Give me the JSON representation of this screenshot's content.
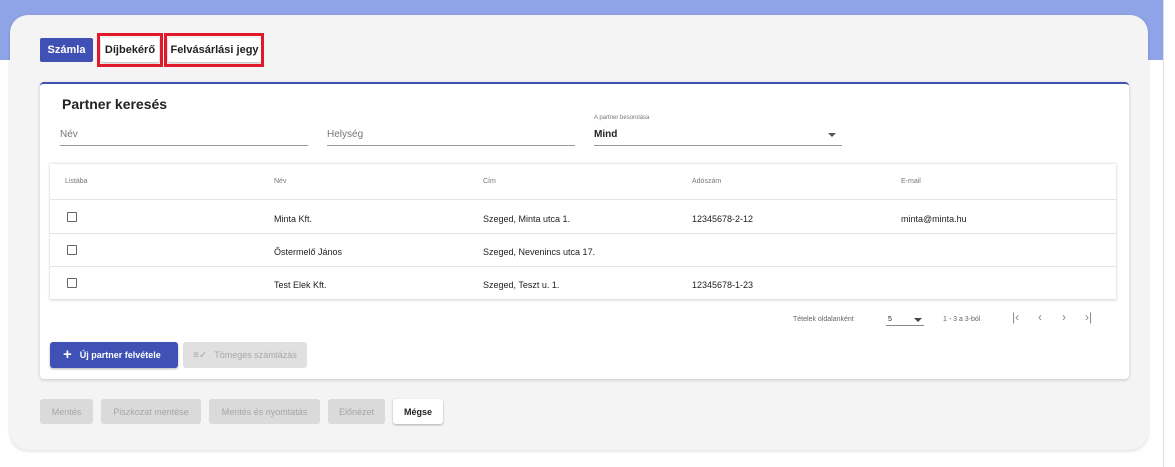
{
  "colors": {
    "primary": "#3f51b5",
    "highlight": "#e0192b",
    "band": "#8fa4e6"
  },
  "doc_tabs": [
    {
      "label": "Számla",
      "active": true
    },
    {
      "label": "Díjbekérő",
      "active": false
    },
    {
      "label": "Felvásárlási jegy",
      "active": false
    }
  ],
  "partner_search": {
    "title": "Partner keresés",
    "name_label": "Név",
    "city_label": "Helység",
    "class_label": "A partner besorolása",
    "class_value": "Mind"
  },
  "table": {
    "headers": [
      "Listába",
      "Név",
      "Cím",
      "Adószám",
      "E-mail"
    ],
    "rows": [
      {
        "name": "Minta Kft.",
        "address": "Szeged, Minta utca 1.",
        "tax": "12345678-2-12",
        "email": "minta@minta.hu"
      },
      {
        "name": "Őstermelő János",
        "address": "Szeged, Nevenincs utca 17.",
        "tax": "",
        "email": ""
      },
      {
        "name": "Test Elek Kft.",
        "address": "Szeged, Teszt u. 1.",
        "tax": "12345678-1-23",
        "email": ""
      }
    ]
  },
  "pagination": {
    "per_page_label": "Tételek oldalanként",
    "per_page_value": "5",
    "range": "1 - 3 a 3-ból"
  },
  "actions": {
    "add_partner": "Új partner felvétele",
    "bulk_invoice": "Tömeges számlázás"
  },
  "footer": {
    "save": "Mentés",
    "save_draft": "Piszkozat mentése",
    "save_print": "Mentés és nyomtatás",
    "preview": "Előnézet",
    "cancel": "Mégse"
  },
  "icons": {
    "plus": "+",
    "bulk": "≡✓",
    "first": "|‹",
    "prev": "‹",
    "next": "›",
    "last": "›|"
  }
}
